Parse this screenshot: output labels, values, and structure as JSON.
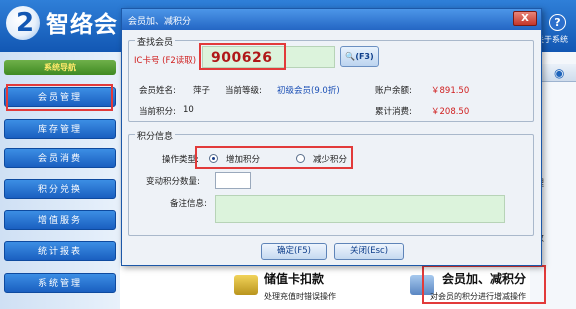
{
  "app": {
    "title": "智络会",
    "logo_mark": "2",
    "help_label": "关于系统",
    "help_glyph": "?"
  },
  "sidebar": {
    "header": "系统导航",
    "items": [
      {
        "label": "会员管理"
      },
      {
        "label": "库存管理"
      },
      {
        "label": "会员消费"
      },
      {
        "label": "积分兑换"
      },
      {
        "label": "增值服务"
      },
      {
        "label": "统计报表"
      },
      {
        "label": "系统管理"
      }
    ]
  },
  "right_panel": {
    "fragments": [
      "理",
      "数"
    ]
  },
  "bottom_cards": [
    {
      "title": "储值卡扣款",
      "subtitle": "处理充值时错误操作"
    },
    {
      "title": "会员加、减积分",
      "subtitle": "对会员的积分进行增减操作"
    }
  ],
  "dialog": {
    "title": "会员加、减积分",
    "close_glyph": "X",
    "search_group": {
      "legend": "查找会员",
      "ic_label": "IC卡号 (F2读取)",
      "ic_value": "900626",
      "search_button": "(F3)",
      "member_name_label": "会员姓名:",
      "member_name": "萍子",
      "level_label": "当前等级:",
      "level": "初级会员(9.0折)",
      "balance_label": "账户余额:",
      "balance": "￥891.50",
      "points_label": "当前积分:",
      "points": "10",
      "total_consume_label": "累计消费:",
      "total_consume": "￥208.50"
    },
    "points_group": {
      "legend": "积分信息",
      "op_type_label": "操作类型:",
      "op_add": "增加积分",
      "op_sub": "减少积分",
      "selected": "增加积分",
      "change_qty_label": "变动积分数量:",
      "change_qty_value": "",
      "remark_label": "备注信息:",
      "remark_value": ""
    },
    "confirm_button": "确定(F5)",
    "close_button": "关闭(Esc)"
  },
  "colors": {
    "accent": "#1a5fc0",
    "highlight": "#e23a3a",
    "money": "#d02020"
  }
}
